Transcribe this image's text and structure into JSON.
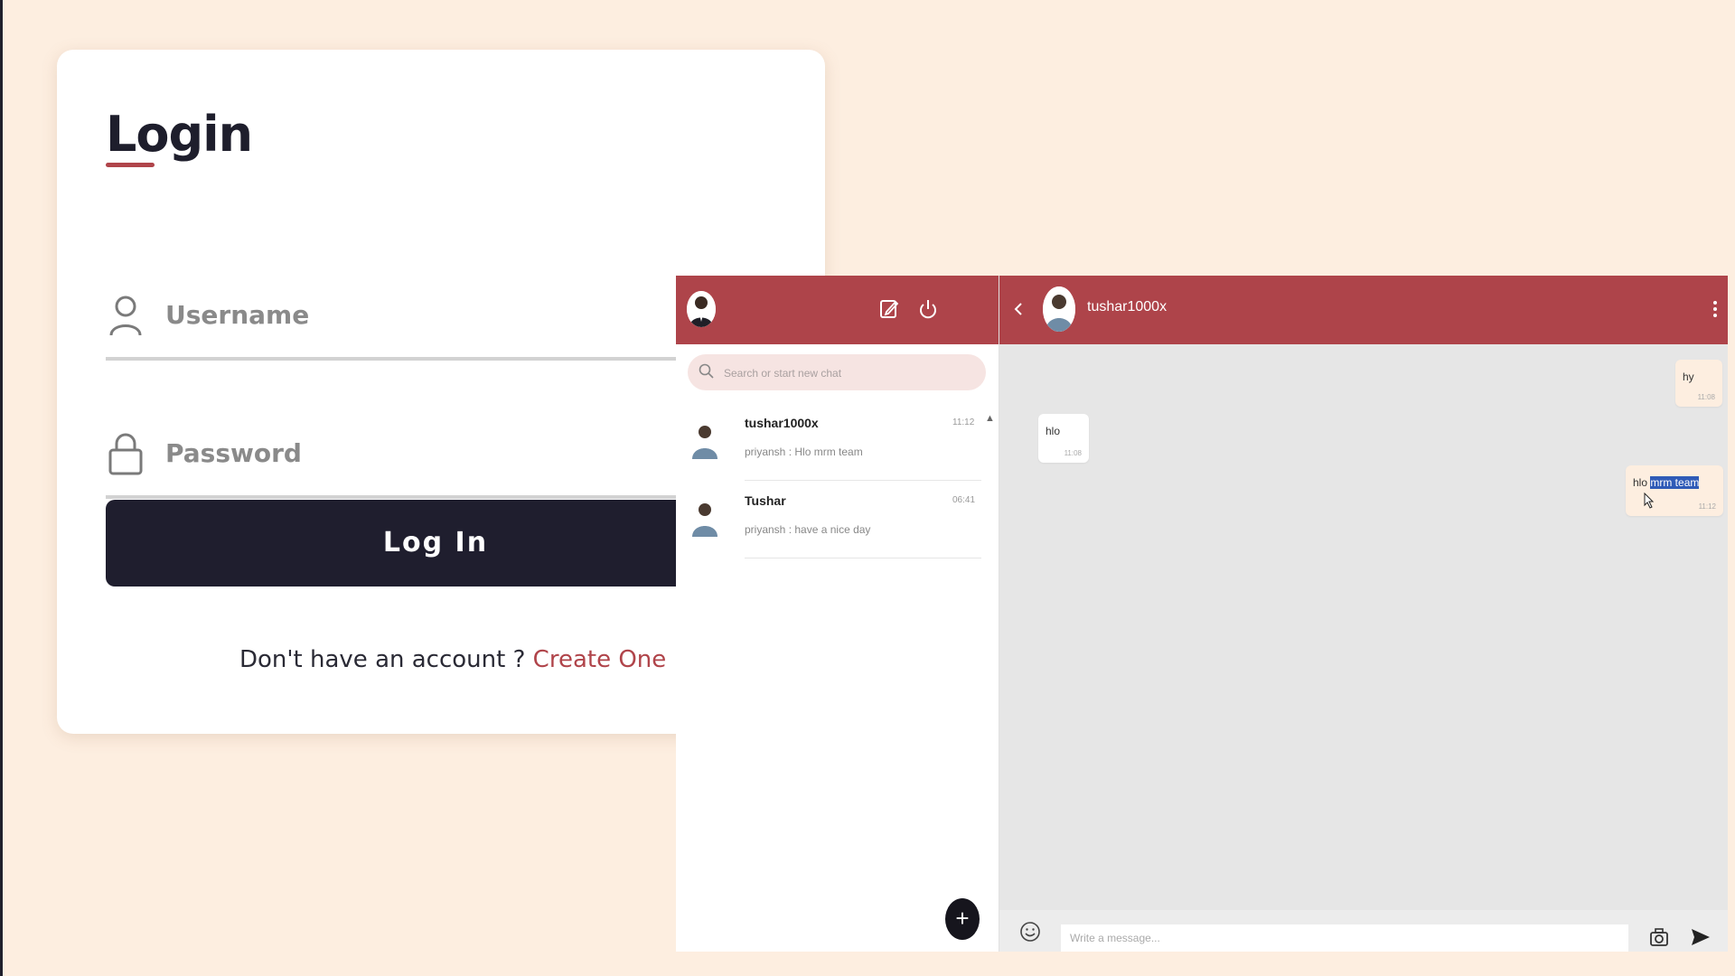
{
  "login": {
    "title": "Login",
    "username_placeholder": "Username",
    "password_placeholder": "Password",
    "button_label": "Log In",
    "signup_prompt": "Don't have an account ?",
    "signup_link": "Create One"
  },
  "sidebar": {
    "search_placeholder": "Search or start new chat",
    "chats": [
      {
        "name": "tushar1000x",
        "time": "11:12",
        "preview": "priyansh : Hlo mrm team"
      },
      {
        "name": "Tushar",
        "time": "06:41",
        "preview": "priyansh : have a nice day"
      }
    ],
    "fab_label": "+"
  },
  "conversation": {
    "contact_name": "tushar1000x",
    "messages": [
      {
        "text": "hy",
        "time": "11:08",
        "direction": "out"
      },
      {
        "text": "hlo",
        "time": "11:08",
        "direction": "in"
      },
      {
        "text_plain": "hlo ",
        "text_selected": "mrm team",
        "time": "11:12",
        "direction": "out"
      }
    ],
    "input_placeholder": "Write a message..."
  },
  "colors": {
    "background": "#fdeee0",
    "accent": "#ae444a",
    "login_button": "#1f1e2e",
    "link": "#b0444a"
  }
}
